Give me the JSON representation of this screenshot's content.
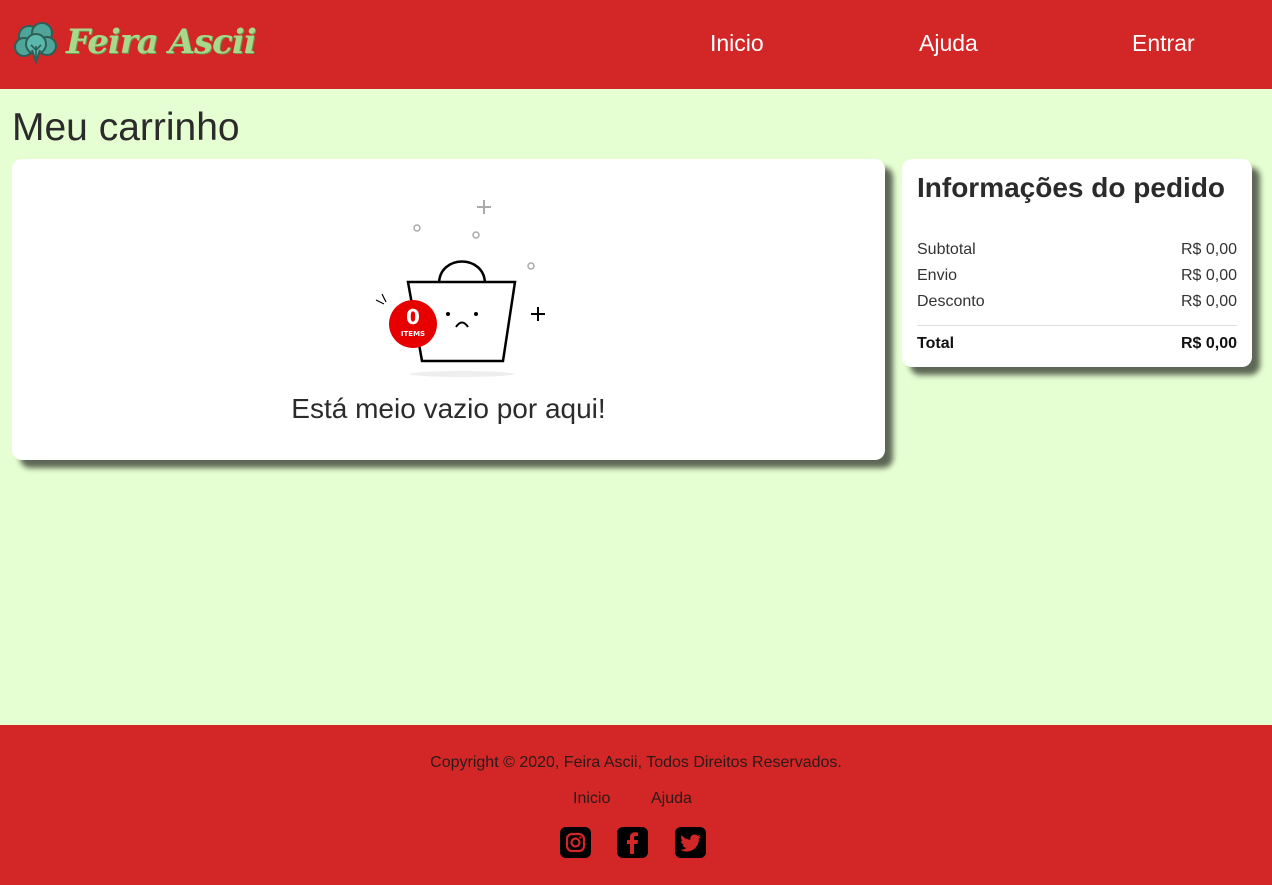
{
  "header": {
    "brand_name": "Feira Ascii",
    "logo_icon": "broccoli-icon",
    "nav": {
      "inicio": "Inicio",
      "ajuda": "Ajuda",
      "entrar": "Entrar"
    }
  },
  "main": {
    "title": "Meu carrinho",
    "cart": {
      "illustration_icon": "empty-bag-icon",
      "badge_count": "0",
      "badge_label": "ITEMS",
      "empty_text": "Está meio vazio por aqui!"
    },
    "order": {
      "title": "Informações do pedido",
      "rows": [
        {
          "label": "Subtotal",
          "value": "R$ 0,00"
        },
        {
          "label": "Envio",
          "value": "R$ 0,00"
        },
        {
          "label": "Desconto",
          "value": "R$ 0,00"
        }
      ],
      "total_label": "Total",
      "total_value": "R$ 0,00"
    }
  },
  "footer": {
    "copyright": "Copyright © 2020, Feira Ascii, Todos Direitos Reservados.",
    "links": {
      "inicio": "Inicio",
      "ajuda": "Ajuda"
    },
    "social": [
      "instagram-icon",
      "facebook-icon",
      "twitter-icon"
    ]
  },
  "colors": {
    "header_bg": "#d32626",
    "page_bg": "#e6ffd2",
    "brand_text": "#a8d98a",
    "badge_red": "#e60000"
  }
}
